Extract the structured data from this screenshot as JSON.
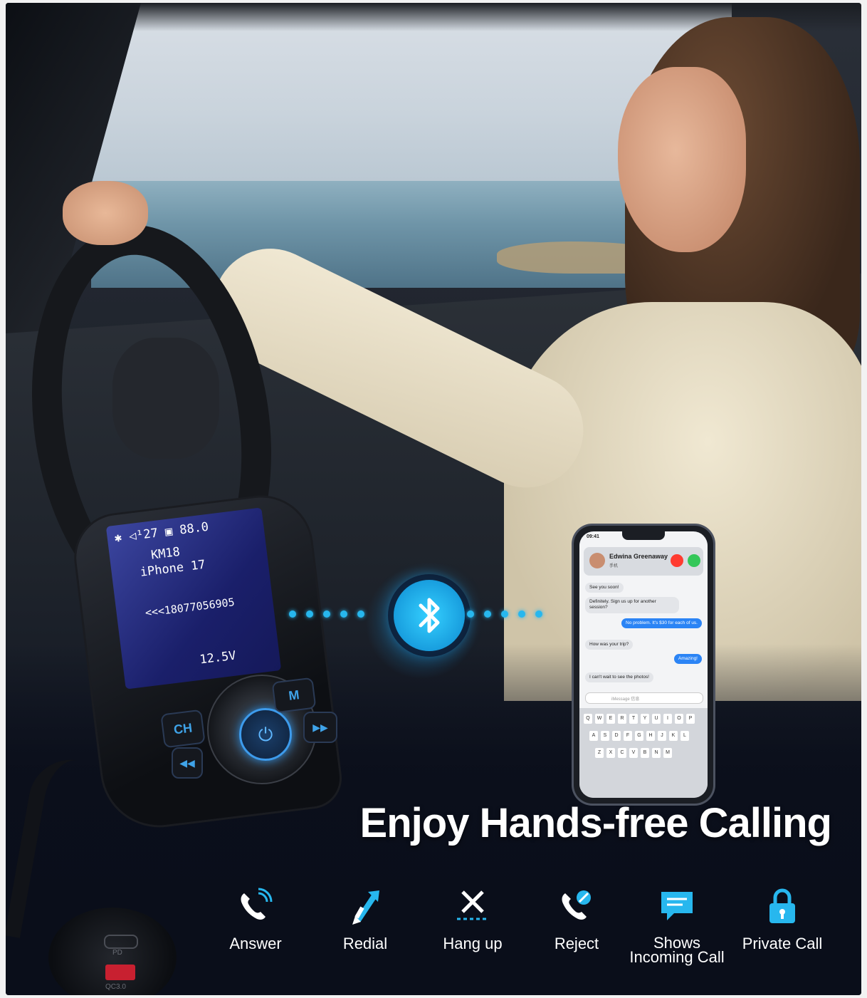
{
  "headline": "Enjoy Hands-free Calling",
  "device": {
    "screen": {
      "status_row": "✱ ◁¹27 ▣ 88.0",
      "line1": "KM18",
      "line2": "iPhone 17",
      "caller_number": "<<<18077056905",
      "voltage": "12.5V"
    },
    "buttons": {
      "ch": "CH",
      "m": "M",
      "next": "▶▶",
      "prev": "◀◀"
    },
    "ports": {
      "pd": "PD",
      "qc": "QC3.0"
    }
  },
  "phone": {
    "time": "09:41",
    "caller_name": "Edwina Greenaway",
    "caller_sub": "手机",
    "messages": [
      {
        "dir": "in",
        "text": "See you soon!"
      },
      {
        "dir": "in",
        "text": "Definitely. Sign us up for another session?"
      },
      {
        "dir": "out",
        "text": "No problem. It's $30 for each of us."
      },
      {
        "dir": "in",
        "text": "How was your trip?"
      },
      {
        "dir": "out",
        "text": "Amazing!"
      },
      {
        "dir": "in",
        "text": "I can't wait to see the photos!"
      }
    ],
    "message_placeholder": "iMessage 信息",
    "keyboard_rows": [
      [
        "Q",
        "W",
        "E",
        "R",
        "T",
        "Y",
        "U",
        "I",
        "O",
        "P"
      ],
      [
        "A",
        "S",
        "D",
        "F",
        "G",
        "H",
        "J",
        "K",
        "L"
      ],
      [
        "Z",
        "X",
        "C",
        "V",
        "B",
        "N",
        "M"
      ]
    ]
  },
  "features": [
    {
      "label": "Answer",
      "icon": "phone-answer-icon"
    },
    {
      "label": "Redial",
      "icon": "redial-arrows-icon"
    },
    {
      "label": "Hang up",
      "icon": "hang-up-x-icon"
    },
    {
      "label": "Reject",
      "icon": "phone-reject-icon"
    },
    {
      "label": "Shows Incoming Call",
      "icon": "message-display-icon"
    },
    {
      "label": "Private Call",
      "icon": "padlock-icon"
    }
  ],
  "colors": {
    "accent": "#27b7ee",
    "headline": "#ffffff",
    "background": "#0a0e1a"
  }
}
